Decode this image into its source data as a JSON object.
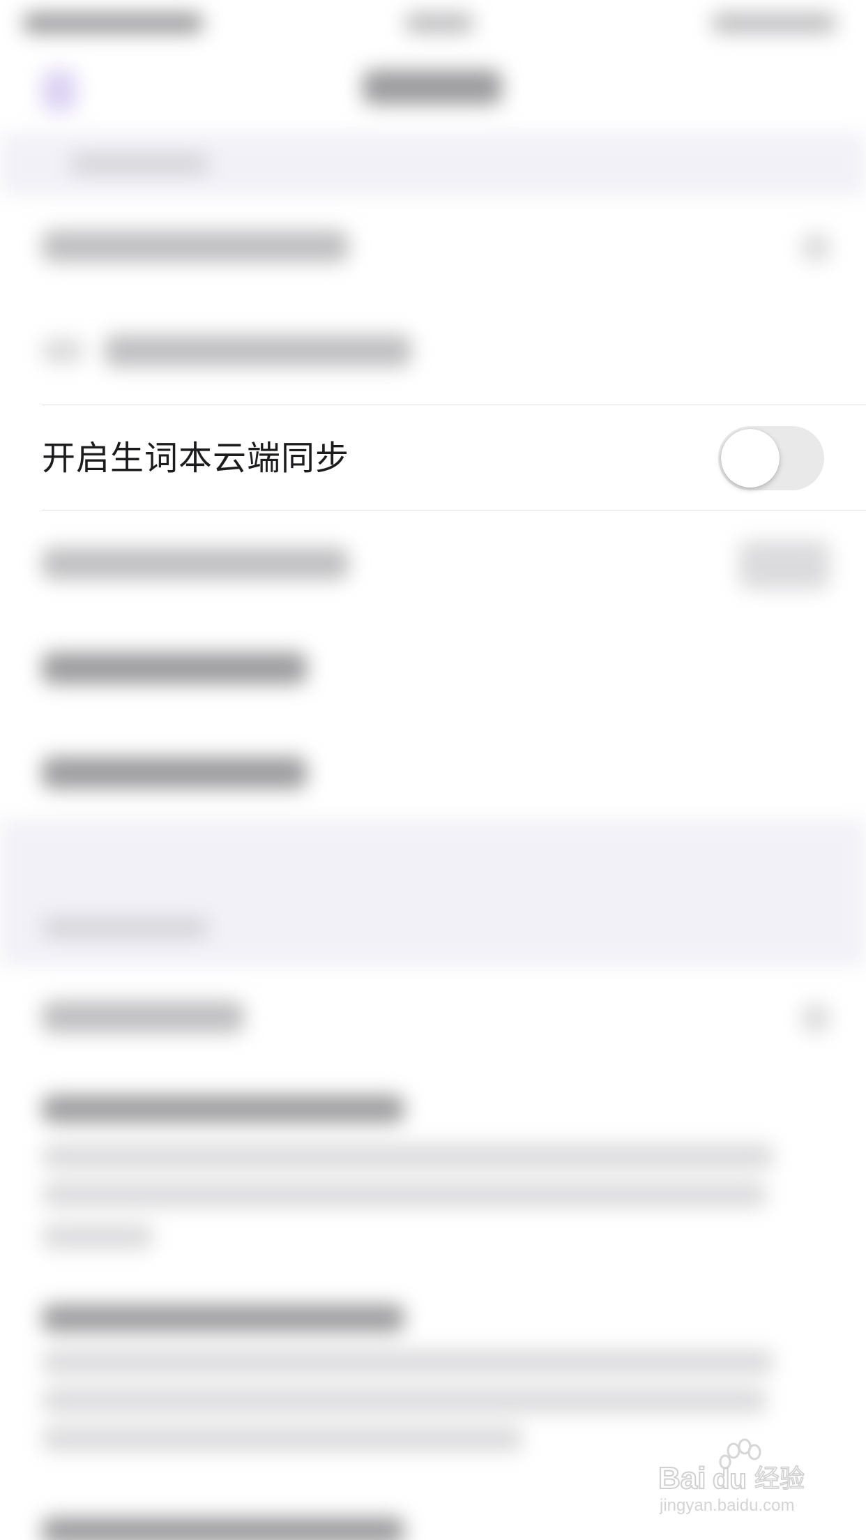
{
  "settings": {
    "sync_label": "开启生词本云端同步",
    "sync_enabled": false
  },
  "colors": {
    "toggle_off_track": "#e9e9ea",
    "group_background": "#f2f1f7",
    "text_primary": "#1c1c1e"
  },
  "watermark": {
    "brand": "Baidu经验",
    "url": "jingyan.baidu.com"
  }
}
